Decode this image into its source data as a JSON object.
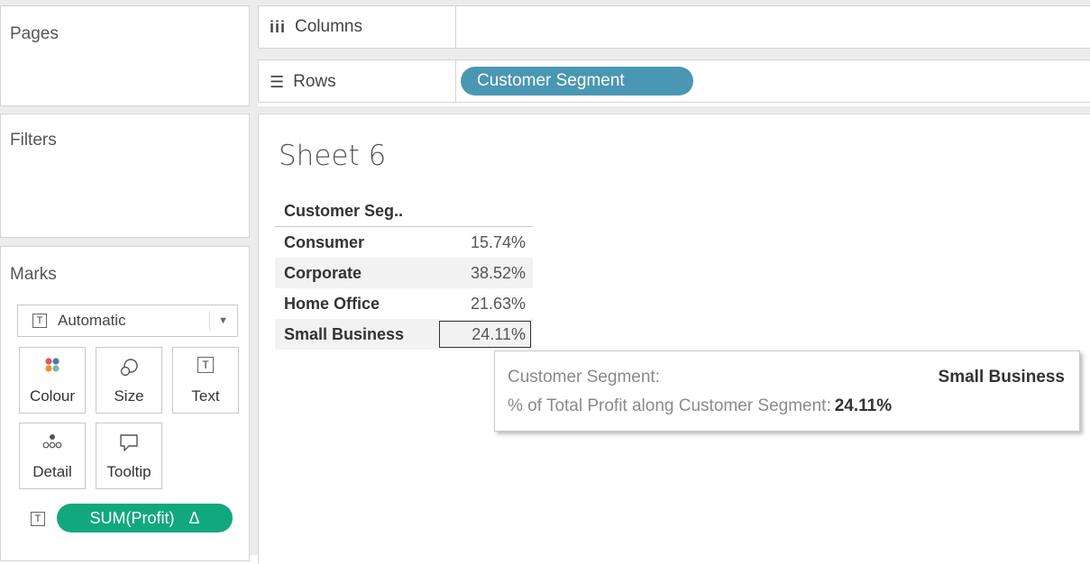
{
  "panels": {
    "pages_title": "Pages",
    "filters_title": "Filters",
    "marks_title": "Marks"
  },
  "shelves": {
    "columns_label": "Columns",
    "rows_label": "Rows",
    "rows_pill": "Customer Segment"
  },
  "marks": {
    "type": "Automatic",
    "buttons": {
      "colour": "Colour",
      "size": "Size",
      "text": "Text",
      "detail": "Detail",
      "tooltip": "Tooltip"
    },
    "field_pill": "SUM(Profit)",
    "field_pill_delta": "Δ"
  },
  "view": {
    "sheet_title": "Sheet 6",
    "column_header": "Customer Seg..",
    "rows": [
      {
        "label": "Consumer",
        "value": "15.74%"
      },
      {
        "label": "Corporate",
        "value": "38.52%"
      },
      {
        "label": "Home Office",
        "value": "21.63%"
      },
      {
        "label": "Small Business",
        "value": "24.11%"
      }
    ]
  },
  "tooltip": {
    "key1": "Customer Segment:",
    "value1": "Small Business",
    "key2": "% of Total Profit along Customer Segment:",
    "value2": "24.11%"
  },
  "colors": {
    "rows_pill": "#4a97b3",
    "measure_pill": "#12a87f",
    "colour_dots": [
      "#e15759",
      "#4e79a7",
      "#f28e2b",
      "#76b7b2"
    ]
  }
}
